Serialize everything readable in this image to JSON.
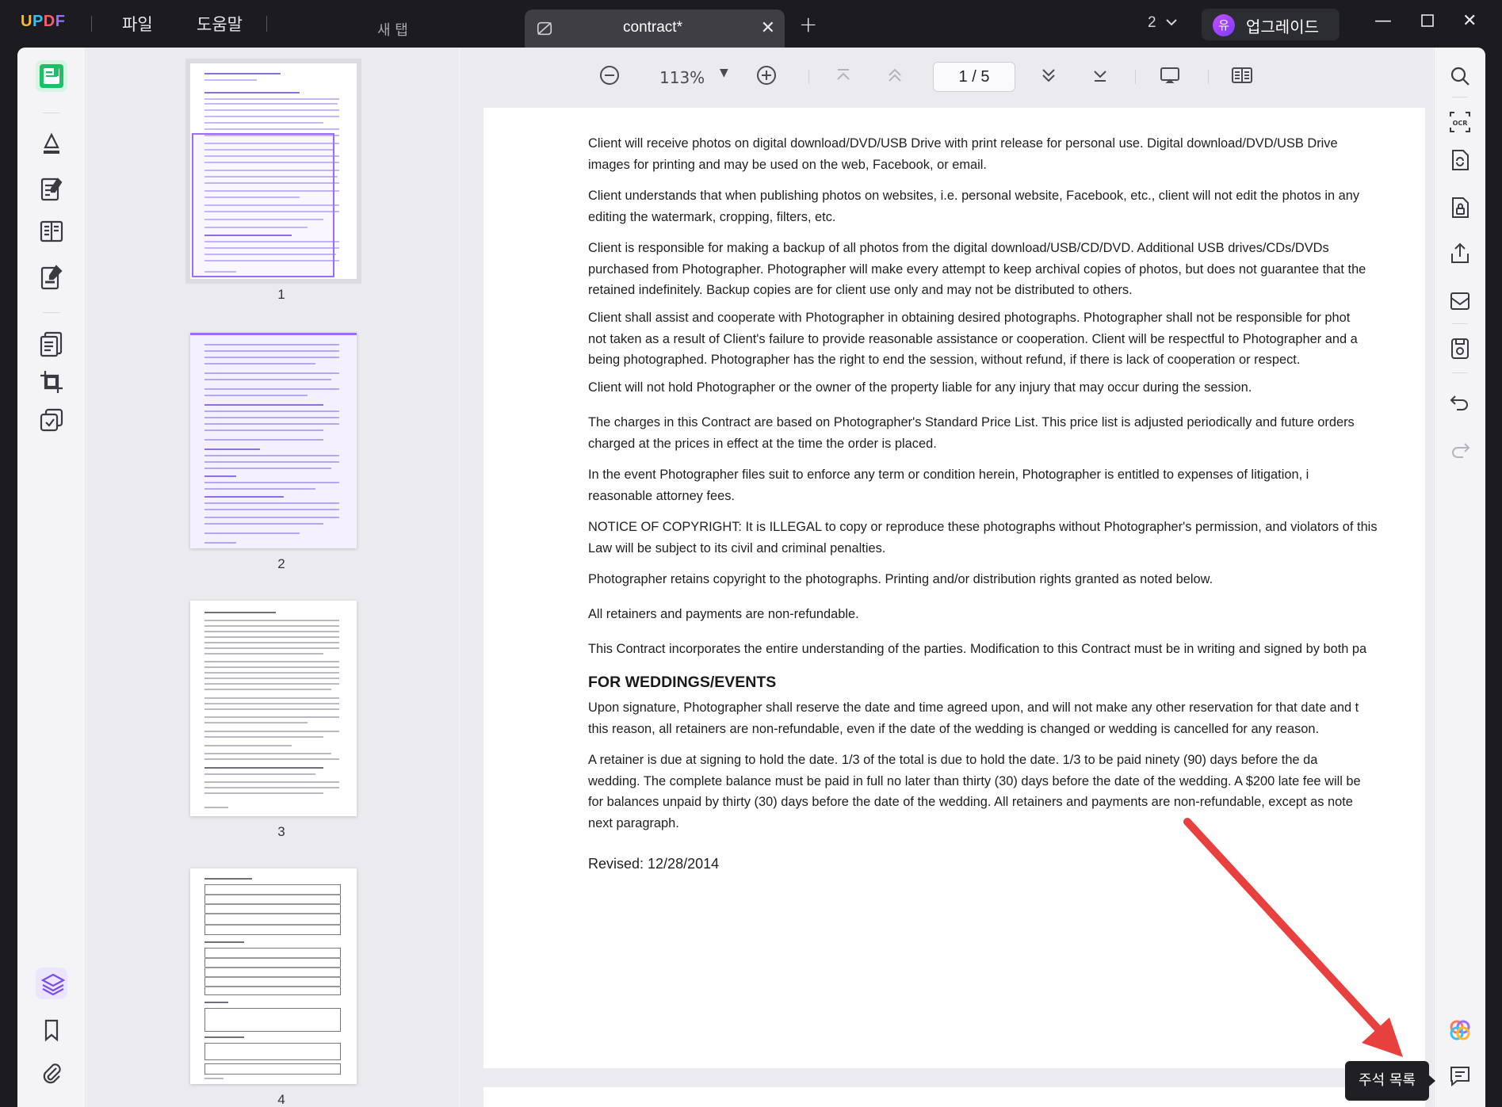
{
  "app": {
    "logo": "UPDF",
    "menu": [
      "파일",
      "도움말"
    ],
    "new_tab_label": "새 탭",
    "active_tab": "contract*",
    "tab_count": "2",
    "upgrade_avatar": "유",
    "upgrade_label": "업그레이드"
  },
  "toolbar": {
    "zoom": "113%",
    "page_indicator": "1 / 5"
  },
  "thumbnails": [
    {
      "label": "1",
      "selected": true
    },
    {
      "label": "2",
      "selected": false
    },
    {
      "label": "3",
      "selected": false
    },
    {
      "label": "4",
      "selected": false
    }
  ],
  "document": {
    "paragraphs": [
      "Client will receive photos on digital download/DVD/USB Drive with print release for personal use. Digital download/DVD/USB Drive\nimages for printing and may be used on the web, Facebook, or email.",
      "Client understands that when publishing photos on websites, i.e. personal website, Facebook, etc., client will not edit the photos in any\nediting the watermark, cropping, filters, etc.",
      "Client is responsible for making a backup of all photos from the digital download/USB/CD/DVD. Additional USB drives/CDs/DVDs\npurchased from Photographer. Photographer will make every attempt to keep archival copies of photos, but does not guarantee that the\nretained indefinitely. Backup copies are for client use only and may not be distributed to others.",
      "Client shall assist and cooperate with Photographer in obtaining desired photographs. Photographer shall not be responsible for phot\nnot taken as a result of Client's failure to provide reasonable assistance or cooperation. Client will be respectful to Photographer and a\nbeing photographed. Photographer has the right to end the session, without refund, if there is lack of cooperation or respect.",
      "Client will not hold Photographer or the owner of the property liable for any injury that may occur during the session.",
      "The charges in this Contract are based on Photographer's Standard Price List. This price list is adjusted periodically and future orders\ncharged at the prices in effect at the time the order is placed.",
      "In the event Photographer files suit to enforce any term or condition herein, Photographer is entitled to expenses of litigation, i\nreasonable attorney fees.",
      "NOTICE OF COPYRIGHT: It is ILLEGAL to copy or reproduce these photographs without Photographer's permission, and violators of this\nLaw will be subject to its civil and criminal penalties.",
      "Photographer retains copyright to the photographs. Printing and/or distribution rights granted as noted below.",
      "All retainers and payments are non-refundable.",
      "This Contract incorporates the entire understanding of the parties. Modification to this Contract must be in writing and signed by both pa"
    ],
    "heading": "FOR WEDDINGS/EVENTS",
    "wedding_paragraphs": [
      "Upon signature, Photographer shall reserve the date and time agreed upon, and will not make any other reservation for that date and t\nthis reason, all retainers are non-refundable, even if the date of the wedding is changed or wedding is cancelled for any reason.",
      "A retainer is due at signing to hold the date. 1/3 of the total is due to hold the date. 1/3 to be paid ninety (90) days before the da\nwedding. The complete balance must be paid in full no later than thirty (30) days before the date of the wedding. A $200 late fee will be\nfor balances unpaid by thirty (30) days before the date of the wedding. All retainers and payments are non-refundable, except as note\nnext paragraph."
    ],
    "revised": "Revised: 12/28/2014"
  },
  "tooltip": "주석 목록",
  "colors": {
    "accent": "#9b6cff",
    "titlebar": "#1b1b20",
    "annotation_arrow": "#e8403f"
  }
}
